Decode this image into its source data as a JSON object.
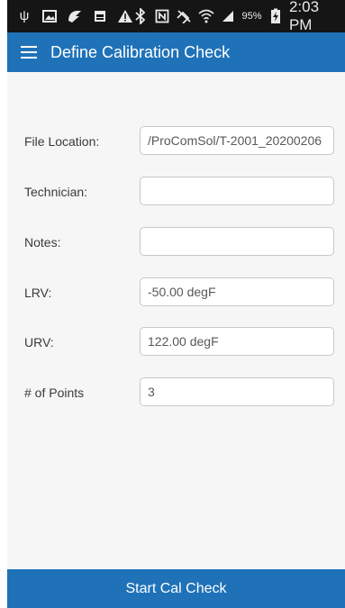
{
  "status_bar": {
    "left_icons": [
      "usb-icon",
      "image-icon",
      "app-icon",
      "sim-icon",
      "warning-icon"
    ],
    "right_icons": [
      "bluetooth-icon",
      "nfc-icon",
      "mute-icon",
      "wifi-icon",
      "signal-icon"
    ],
    "battery_percent": "95%",
    "time": "2:03 PM"
  },
  "app_bar": {
    "menu_icon": "hamburger-menu-icon",
    "title": "Define Calibration Check"
  },
  "form": {
    "file_location": {
      "label": "File Location:",
      "value": "/ProComSol/T-2001_20200206"
    },
    "technician": {
      "label": "Technician:",
      "value": ""
    },
    "notes": {
      "label": "Notes:",
      "value": ""
    },
    "lrv": {
      "label": "LRV:",
      "value": "-50.00 degF"
    },
    "urv": {
      "label": "URV:",
      "value": "122.00 degF"
    },
    "points": {
      "label": "# of Points",
      "value": "3"
    }
  },
  "footer": {
    "start_button_label": "Start Cal Check"
  },
  "colors": {
    "primary": "#1f72b8",
    "status_bar": "#151515",
    "content_background": "#f6f6f6"
  }
}
